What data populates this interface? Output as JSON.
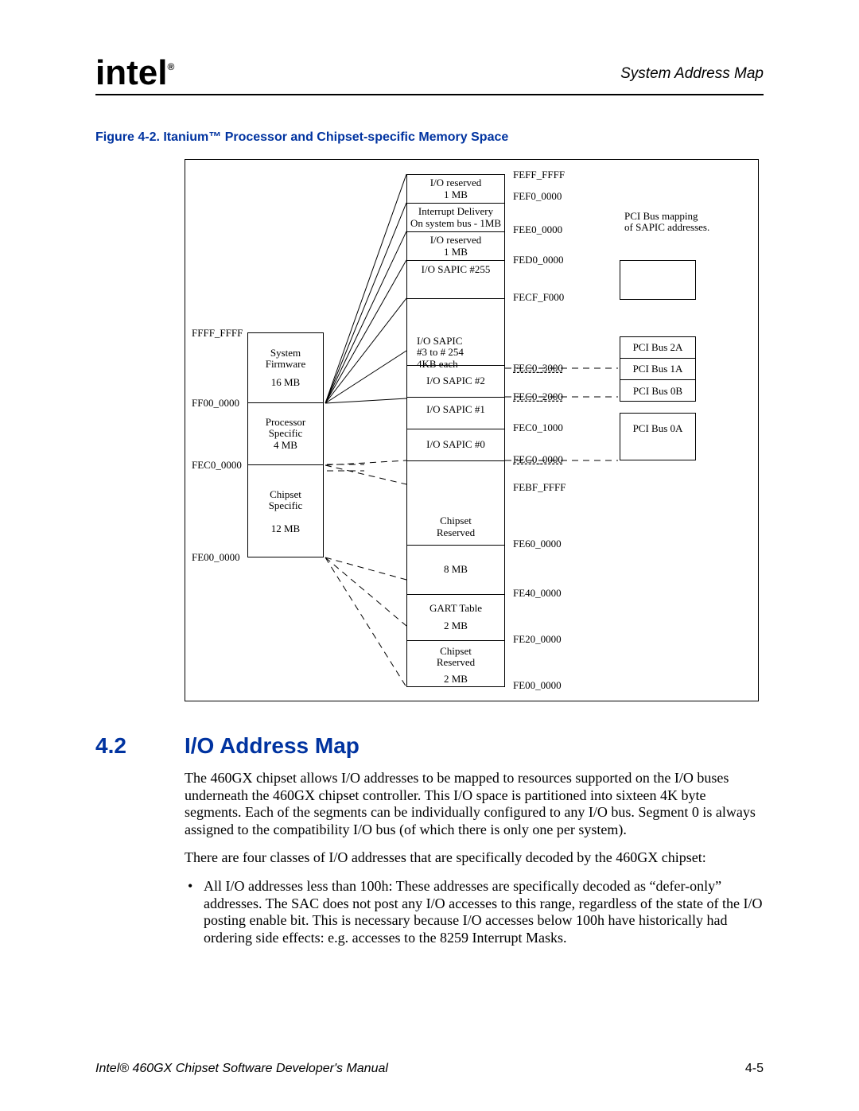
{
  "header": {
    "logo": "int",
    "logo_e": "e",
    "logo_l": "l",
    "reg": "®",
    "right": "System Address Map"
  },
  "figure_title": "Figure 4-2. Itanium™ Processor and Chipset-specific Memory Space",
  "left_col": {
    "addr0": "FFFF_FFFF",
    "box0": {
      "l1": "System",
      "l2": "Firmware",
      "l3": "16 MB"
    },
    "addr1": "FF00_0000",
    "box1": {
      "l1": "Processor",
      "l2": "Specific",
      "l3": "4 MB"
    },
    "addr2": "FEC0_0000",
    "box2": {
      "l1": "Chipset",
      "l2": "Specific",
      "l3": "12 MB"
    },
    "addr3": "FE00_0000"
  },
  "mid_col": {
    "c0": {
      "l1": "I/O reserved",
      "l2": "1 MB"
    },
    "c1": {
      "l1": "Interrupt Delivery",
      "l2": "On system bus - 1MB"
    },
    "c2": {
      "l1": "I/O reserved",
      "l2": "1 MB"
    },
    "c3": {
      "l1": "I/O SAPIC #255"
    },
    "c4": {
      "l1": "I/O SAPIC",
      "l2": "#3 to # 254",
      "l3": "4KB each"
    },
    "c5": {
      "l1": "I/O SAPIC #2"
    },
    "c6": {
      "l1": "I/O SAPIC #1"
    },
    "c7": {
      "l1": "I/O SAPIC #0"
    },
    "c8": {
      "l1": "Chipset",
      "l2": "Reserved"
    },
    "c9": {
      "l1": "8 MB"
    },
    "c10": {
      "l1": "GART Table",
      "l2": "2 MB"
    },
    "c11": {
      "l1": "Chipset",
      "l2": "Reserved",
      "l3": "2 MB"
    }
  },
  "mid_addr": {
    "a0": "FEFF_FFFF",
    "a1": "FEF0_0000",
    "a2": "FEE0_0000",
    "a3": "FED0_0000",
    "a4": "FECF_F000",
    "a5": "FEC0_3000",
    "a6": "FEC0_2000",
    "a7": "FEC0_1000",
    "a8": "FEC0_0000",
    "a9": "FEBF_FFFF",
    "a10": "FE60_0000",
    "a11": "FE40_0000",
    "a12": "FE20_0000",
    "a13": "FE00_0000"
  },
  "right_note": {
    "l1": "PCI Bus mapping",
    "l2": "of SAPIC addresses."
  },
  "right_col": {
    "r0": "PCI Bus 2A",
    "r1": "PCI Bus 1A",
    "r2": "PCI Bus 0B",
    "r3": "PCI Bus 0A"
  },
  "section": {
    "num": "4.2",
    "title": "I/O Address Map"
  },
  "para1": "The 460GX chipset allows I/O addresses to be mapped to resources supported on the I/O buses underneath the 460GX chipset controller. This I/O space is partitioned into sixteen 4K byte segments. Each of the segments can be individually configured to any I/O bus. Segment 0 is always assigned to the compatibility I/O bus (of which there is only one per system).",
  "para2": "There are four classes of I/O addresses that are specifically decoded by the 460GX chipset:",
  "bullet1": "All I/O addresses less than 100h: These addresses are specifically decoded as “defer-only” addresses. The SAC does not post any I/O accesses to this range, regardless of the state of the I/O posting enable bit. This is necessary because I/O accesses below 100h have historically had ordering side effects: e.g. accesses to the 8259 Interrupt Masks.",
  "footer_left": "Intel® 460GX Chipset Software Developer's Manual",
  "footer_right": "4-5"
}
